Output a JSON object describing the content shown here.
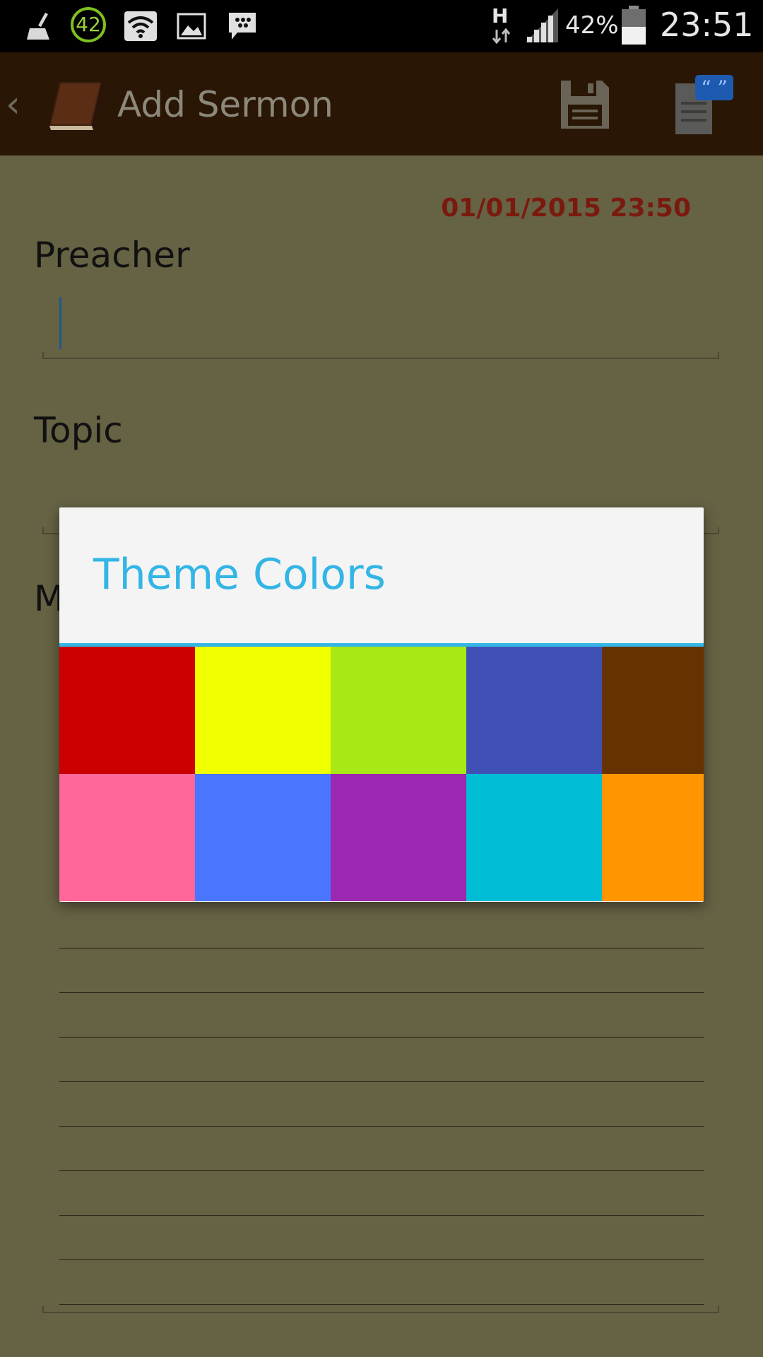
{
  "status_bar": {
    "notification_count": "42",
    "network_type": "H",
    "battery_percent": "42%",
    "time": "23:51",
    "icons": [
      "cleaner-icon",
      "counter-badge-icon",
      "wifi-icon",
      "gallery-icon",
      "bbm-icon",
      "data-transfer-icon",
      "signal-icon",
      "battery-icon"
    ]
  },
  "action_bar": {
    "back_icon": "chevron-left-icon",
    "logo_icon": "book-icon",
    "title": "Add Sermon",
    "save_icon": "floppy-disk-icon",
    "quote_icon": "quote-note-icon",
    "background": "#2a1604"
  },
  "form": {
    "timestamp": "01/01/2015  23:50",
    "preacher_label": "Preacher",
    "preacher_value": "",
    "topic_label": "Topic",
    "topic_value": "",
    "message_label_partial": "M",
    "background": "#666244"
  },
  "dialog": {
    "title": "Theme Colors",
    "accent": "#33b5e5",
    "colors": [
      "#cc0000",
      "#f2ff00",
      "#a8e815",
      "#3f51b5",
      "#663300",
      "#ff6699",
      "#4a76ff",
      "#9c27b0",
      "#00bcd4",
      "#ff9500"
    ]
  }
}
